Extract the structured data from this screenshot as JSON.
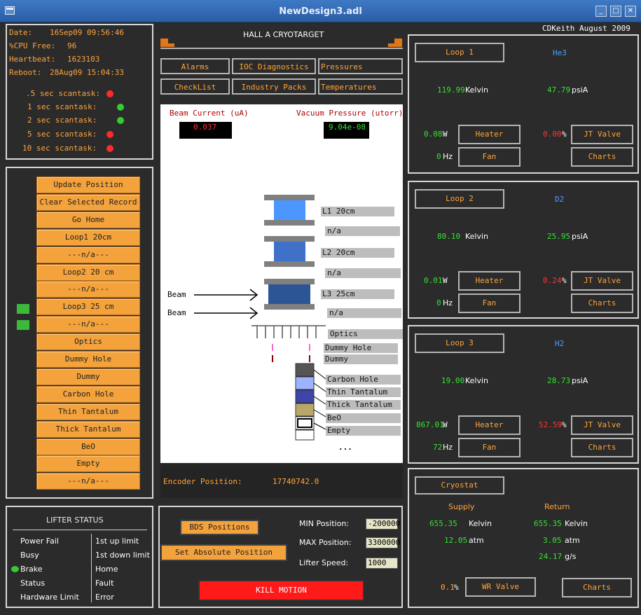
{
  "window": {
    "title": "NewDesign3.adl",
    "minimize_icon": "minimize-icon",
    "maximize_icon": "maximize-icon",
    "close_icon": "close-icon"
  },
  "status": {
    "date_label": "Date:",
    "date_value": "16Sep09 09:56:46",
    "cpu_label": "%CPU Free:",
    "cpu_value": "96",
    "heartbeat_label": "Heartbeat:",
    "heartbeat_value": "1623103",
    "reboot_label": "Reboot:",
    "reboot_value": "28Aug09 15:04:33",
    "scantasks": [
      {
        "label": ".5 sec scantask:",
        "state": "red"
      },
      {
        "label": "1 sec scantask:",
        "state": "green"
      },
      {
        "label": "2 sec scantask:",
        "state": "green"
      },
      {
        "label": "5 sec scantask:",
        "state": "red"
      },
      {
        "label": "10 sec scantask:",
        "state": "red"
      }
    ]
  },
  "header": {
    "title": "HALL A CRYOTARGET",
    "credit": "CDKeith August 2009"
  },
  "nav": {
    "alarms": "Alarms",
    "ioc": "IOC Diagnostics",
    "pressures": "Pressures",
    "checklist": "CheckList",
    "industry": "Industry Packs",
    "temperatures": "Temperatures"
  },
  "target_buttons": [
    "Update Position",
    "Clear Selected Record",
    "Go Home",
    "Loop1 20cm",
    "---n/a---",
    "Loop2 20 cm",
    "---n/a---",
    "Loop3 25 cm",
    "---n/a---",
    "Optics",
    "Dummy Hole",
    "Dummy",
    "Carbon Hole",
    "Thin Tantalum",
    "Thick Tantalum",
    "BeO",
    "Empty",
    "---n/a---"
  ],
  "diagram": {
    "beam_current_label": "Beam Current (uA)",
    "beam_current_value": "0.037",
    "vacuum_label": "Vacuum Pressure (utorr)",
    "vacuum_value": "9.04e-08",
    "beam1": "Beam",
    "beam2": "Beam",
    "labels": [
      "L1 20cm",
      "n/a",
      "L2 20cm",
      "n/a",
      "L3 25cm",
      "n/a",
      "Optics",
      "Dummy Hole",
      "Dummy",
      "Carbon Hole",
      "Thin Tantalum",
      "Thick Tantalum",
      "BeO",
      "Empty"
    ],
    "more": "...",
    "encoder_label": "Encoder Position:",
    "encoder_value": "17740742.0"
  },
  "lifter": {
    "title": "LIFTER STATUS",
    "left": [
      "Power Fail",
      "Busy",
      "Brake",
      "Status",
      "Hardware Limit"
    ],
    "right": [
      "1st up limit",
      "1st down limit",
      "Home",
      "Fault",
      "Error"
    ]
  },
  "motion": {
    "bds_label": "BDS Positions",
    "setabs_label": "Set Absolute Position",
    "min_label": "MIN Position:",
    "min_value": "-200000",
    "max_label": "MAX Position:",
    "max_value": "3300000",
    "speed_label": "Lifter Speed:",
    "speed_value": "1000",
    "kill_label": "KILL MOTION"
  },
  "loops": [
    {
      "name": "Loop 1",
      "gas": "He3",
      "kelvin": "119.99",
      "kelvin_unit": "Kelvin",
      "psia": "47.79",
      "psia_unit": "psiA",
      "heater_value": "0.08",
      "heater_unit": "W",
      "heater_label": "Heater",
      "jt_value": "0.00",
      "jt_unit": "%",
      "jt_label": "JT Valve",
      "fan_value": "0",
      "fan_unit": "Hz",
      "fan_label": "Fan",
      "charts_label": "Charts"
    },
    {
      "name": "Loop 2",
      "gas": "D2",
      "kelvin": "80.10",
      "kelvin_unit": "Kelvin",
      "psia": "25.95",
      "psia_unit": "psiA",
      "heater_value": "0.01",
      "heater_unit": "W",
      "heater_label": "Heater",
      "jt_value": "0.24",
      "jt_unit": "%",
      "jt_label": "JT Valve",
      "fan_value": "0",
      "fan_unit": "Hz",
      "fan_label": "Fan",
      "charts_label": "Charts"
    },
    {
      "name": "Loop 3",
      "gas": "H2",
      "kelvin": "19.00",
      "kelvin_unit": "Kelvin",
      "psia": "28.73",
      "psia_unit": "psiA",
      "heater_value": "867.01",
      "heater_unit": "W",
      "heater_label": "Heater",
      "jt_value": "52.59",
      "jt_unit": "%",
      "jt_label": "JT Valve",
      "fan_value": "72",
      "fan_unit": "Hz",
      "fan_label": "Fan",
      "charts_label": "Charts"
    }
  ],
  "cryostat": {
    "name": "Cryostat",
    "supply": "Supply",
    "return": "Return",
    "supply_kelvin": "655.35",
    "return_kelvin": "655.35",
    "kelvin_unit": "Kelvin",
    "supply_atm": "12.05",
    "return_atm": "3.05",
    "atm_unit": "atm",
    "flow": "24.17",
    "flow_unit": "g/s",
    "wr_value": "0.1",
    "wr_unit": "%",
    "wr_label": "WR Valve",
    "charts_label": "Charts"
  },
  "colors": {
    "orange": "#ffa43b",
    "green": "#35e035",
    "red": "#ff3333",
    "blue": "#4f9dff",
    "button_orange": "#f3a23c",
    "kill_red": "#ff1a1a"
  }
}
